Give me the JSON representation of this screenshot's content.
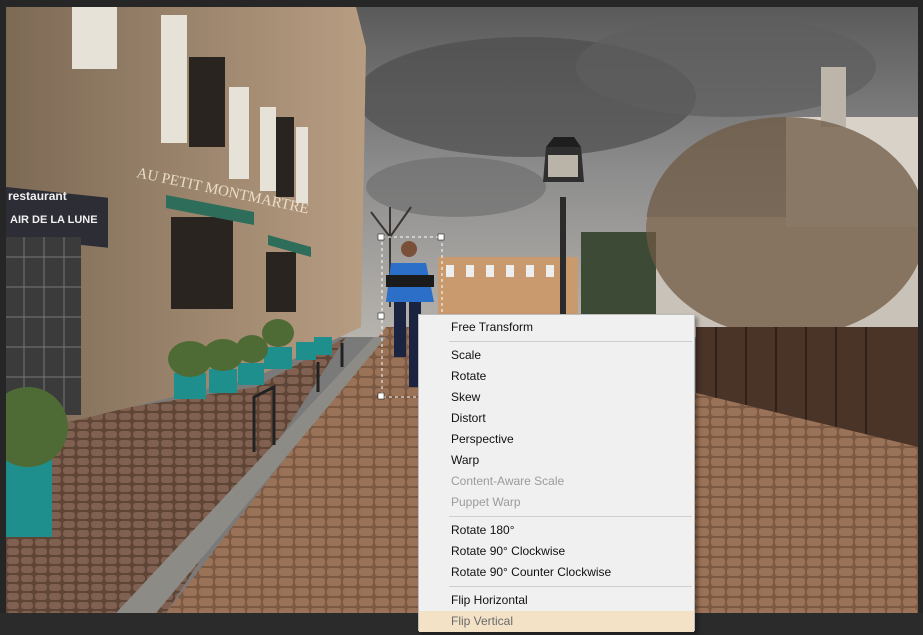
{
  "context_menu": {
    "groups": [
      [
        {
          "label": "Free Transform",
          "enabled": true
        }
      ],
      [
        {
          "label": "Scale",
          "enabled": true
        },
        {
          "label": "Rotate",
          "enabled": true
        },
        {
          "label": "Skew",
          "enabled": true
        },
        {
          "label": "Distort",
          "enabled": true
        },
        {
          "label": "Perspective",
          "enabled": true
        },
        {
          "label": "Warp",
          "enabled": true
        },
        {
          "label": "Content-Aware Scale",
          "enabled": false
        },
        {
          "label": "Puppet Warp",
          "enabled": false
        }
      ],
      [
        {
          "label": "Rotate 180°",
          "enabled": true
        },
        {
          "label": "Rotate 90° Clockwise",
          "enabled": true
        },
        {
          "label": "Rotate 90° Counter Clockwise",
          "enabled": true
        }
      ],
      [
        {
          "label": "Flip Horizontal",
          "enabled": true
        },
        {
          "label": "Flip Vertical",
          "enabled": true,
          "highlighted": true
        }
      ]
    ]
  },
  "photo": {
    "sign_text_1": "restaurant",
    "sign_text_2": "AIR DE LA LUNE",
    "facade_text": "AU PETIT MONTMARTRE"
  },
  "colors": {
    "menu_bg": "#f0f0f0",
    "menu_highlight": "#f3e2c6",
    "disabled_text": "#9b9b9b",
    "canvas_bg": "#262626"
  }
}
